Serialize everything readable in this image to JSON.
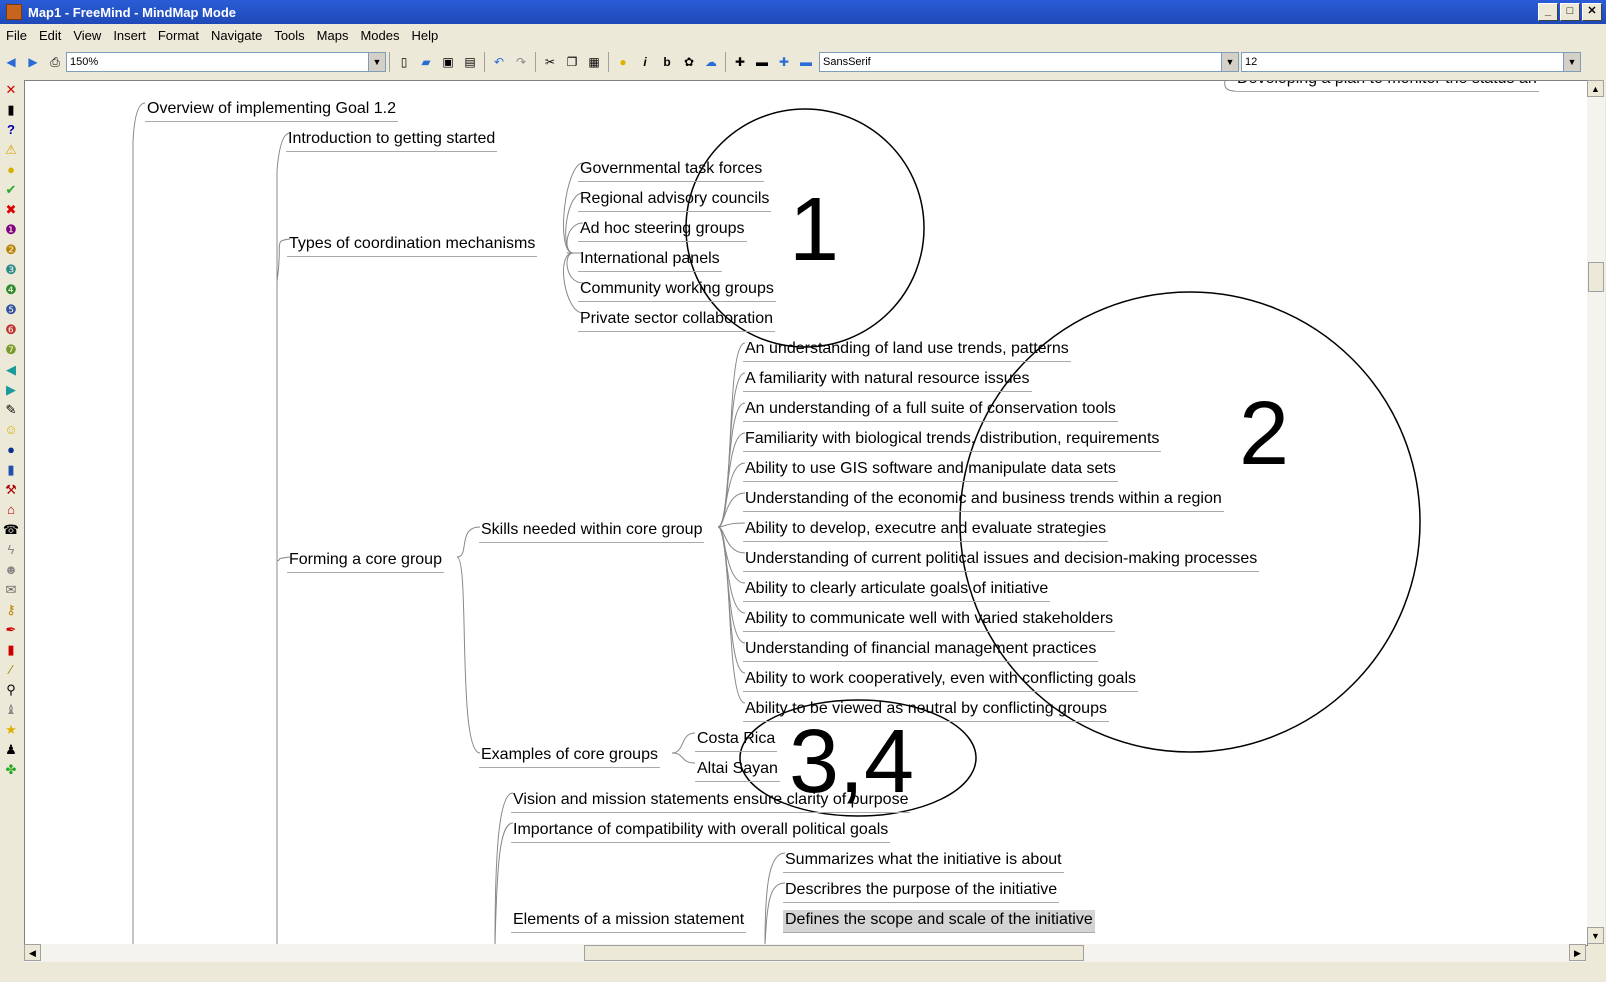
{
  "window": {
    "title": "Map1 - FreeMind - MindMap Mode"
  },
  "menu": [
    "File",
    "Edit",
    "View",
    "Insert",
    "Format",
    "Navigate",
    "Tools",
    "Maps",
    "Modes",
    "Help"
  ],
  "toolbar": {
    "zoom": "150%",
    "font_family": "SansSerif",
    "font_size": "12"
  },
  "nodes": {
    "root": "Overview of implementing Goal 1.2",
    "intro": "Introduction to getting started",
    "types": "Types of coordination mechanisms",
    "types_children": [
      "Governmental task forces",
      "Regional advisory councils",
      "Ad hoc steering groups",
      "International panels",
      "Community working groups",
      "Private sector collaboration"
    ],
    "forming": "Forming a core group",
    "skills": "Skills needed within core group",
    "skills_children": [
      "An understanding of land use trends, patterns",
      "A familiarity with natural resource issues",
      "An understanding of a full suite of conservation tools",
      "Familiarity with biological trends, distribution, requirements",
      "Ability to use GIS software and manipulate data sets",
      "Understanding of the economic and business trends within a region",
      "Ability to develop, executre and evaluate strategies",
      "Understanding of current political issues and decision-making processes",
      "Ability to clearly articulate goals of initiative",
      "Ability to communicate well with varied stakeholders",
      "Understanding of financial management practices",
      "Ability to work cooperatively, even with conflicting goals",
      "Ability to be viewed as neutral by conflicting groups"
    ],
    "examples": "Examples of core groups",
    "examples_children": [
      "Costa Rica",
      "Altai Sayan"
    ],
    "vision": "Vision and mission statements ensure clarity of purpose",
    "compat": "Importance of compatibility with overall political goals",
    "elements": "Elements of a mission statement",
    "elements_children": [
      "Summarizes what the initiative is about",
      "Describres the purpose of the initiative",
      "Defines the scope and scale of the initiative"
    ],
    "topright": "Developing a plan to monitor the status an"
  },
  "annotations": [
    "1",
    "2",
    "3,4"
  ]
}
